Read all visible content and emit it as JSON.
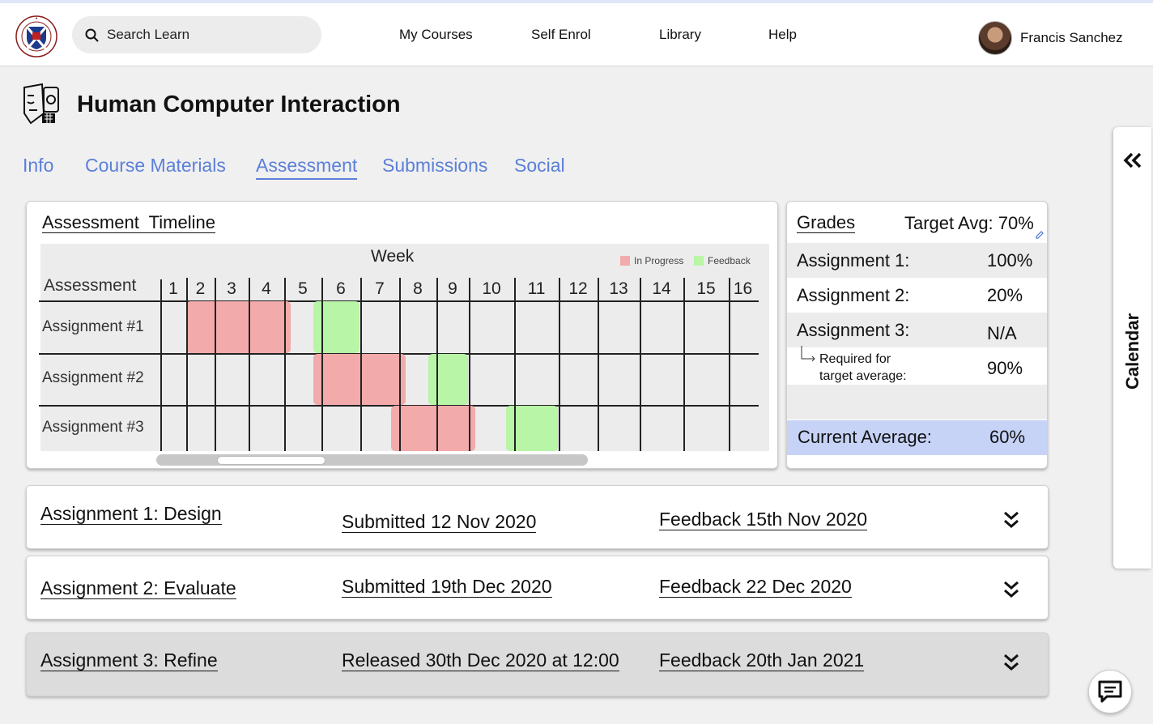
{
  "header": {
    "search_placeholder": "Search Learn",
    "nav": [
      "My Courses",
      "Self Enrol",
      "Library",
      "Help"
    ],
    "user_name": "Francis Sanchez"
  },
  "course": {
    "title": "Human Computer Interaction",
    "tabs": [
      "Info",
      "Course Materials",
      "Assessment",
      "Submissions",
      "Social"
    ],
    "active_tab": "Assessment"
  },
  "timeline": {
    "title": "Assessment  Timeline",
    "week_label": "Week",
    "assessment_header": "Assessment",
    "legend": [
      {
        "label": "In Progress",
        "color": "#f2aaaa"
      },
      {
        "label": "Feedback",
        "color": "#b8f5a6"
      }
    ],
    "weeks": [
      "1",
      "2",
      "3",
      "4",
      "5",
      "6",
      "7",
      "8",
      "9",
      "10",
      "11",
      "12",
      "13",
      "14",
      "15",
      "16"
    ],
    "rows": [
      {
        "label": "Assignment #1",
        "in_progress_weeks": [
          2,
          4
        ],
        "feedback_weeks": [
          6,
          6
        ]
      },
      {
        "label": "Assignment #2",
        "in_progress_weeks": [
          6,
          7
        ],
        "feedback_weeks": [
          9,
          9
        ]
      },
      {
        "label": "Assignment #3",
        "in_progress_weeks": [
          8,
          9
        ],
        "feedback_weeks": [
          11,
          11
        ]
      }
    ],
    "scroll_position": 0.14
  },
  "grades": {
    "title": "Grades",
    "target": "Target Avg: 70%",
    "items": [
      {
        "label": "Assignment 1:",
        "value": "100%"
      },
      {
        "label": "Assignment 2:",
        "value": "20%"
      },
      {
        "label": "Assignment 3:",
        "value": "N/A"
      }
    ],
    "required_label_1": "Required for",
    "required_label_2": "target average:",
    "required_value": "90%",
    "current_label": "Current Average:",
    "current_value": "60%"
  },
  "assignments": [
    {
      "name": "Assignment 1: Design",
      "status": "Submitted 12 Nov 2020",
      "feedback": "Feedback 15th Nov 2020"
    },
    {
      "name": "Assignment 2: Evaluate",
      "status": "Submitted 19th Dec 2020",
      "feedback": "Feedback 22 Dec 2020"
    },
    {
      "name": "Assignment 3: Refine",
      "status": "Released 30th Dec 2020 at 12:00",
      "feedback": "Feedback 20th Jan 2021"
    }
  ],
  "calendar_label": "Calendar",
  "icons": {
    "logo": "university-seal-icon",
    "search": "search-icon",
    "course": "course-robot-icon",
    "expand": "chevron-double-down-icon",
    "calendar_toggle": "chevron-double-left-icon",
    "chat": "chat-icon"
  }
}
